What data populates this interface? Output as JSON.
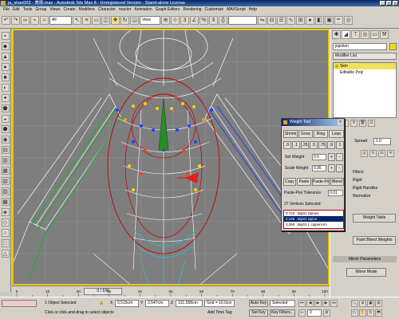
{
  "window": {
    "title": "ja_shan003 - 美術.max - Autodesk 3ds Max 8 - Unregistered Version - Stand-alone License",
    "controls": [
      "_",
      "□",
      "×"
    ]
  },
  "menu": [
    "File",
    "Edit",
    "Tools",
    "Group",
    "Views",
    "Create",
    "Modifiers",
    "Character",
    "reactor",
    "Animation",
    "Graph Editors",
    "Rendering",
    "Customize",
    "MAXScript",
    "Help"
  ],
  "toolbar": {
    "selection_filter": "All",
    "coordinate_system": "View"
  },
  "command_panel": {
    "object_name": "jiqishen",
    "modifier_list_label": "Modifier List",
    "stack": [
      {
        "label": "Skin",
        "active": true
      },
      {
        "label": "Editable Poly",
        "active": false
      }
    ],
    "params": {
      "spinner_label": "Spread",
      "spinner_value": "1.0",
      "filter_label": "Filters",
      "rows": [
        "Rigid",
        "Rigid Handles",
        "Normalize"
      ],
      "weight_table_button": "Weight Table",
      "paint_blend_button": "Paint Blend Weights",
      "mirror_params": "Mirror Parameters",
      "mirror_mode_button": "Mirror Mode"
    }
  },
  "weight_tool": {
    "title": "Weight Tool",
    "buttons_row1": [
      "Shrink",
      "Grow",
      "Ring",
      "Loop"
    ],
    "set_weight_label": "Set Weight",
    "set_weight_value": "0.5",
    "scale_weight_label": "Scale Weight",
    "scale_weight_value": "0.95",
    "preset_weights": [
      ".0",
      ".1",
      ".25",
      ".5",
      ".75",
      ".9",
      "1"
    ],
    "buttons_row2": [
      "Copy",
      "Paste",
      "Paste-Pos",
      "Blend"
    ],
    "paste_tolerance_label": "Paste-Pos Tolerance",
    "paste_tolerance_value": "0.01",
    "vertices_selected": "27 Vertices Selected",
    "bone_list": [
      {
        "text": "0.743 : Bip01 Spine1",
        "selected": false
      },
      {
        "text": "0.226 : Bip01 Spine",
        "selected": true
      },
      {
        "text": "0.250 : Bip01 L UpperArm",
        "selected": false
      }
    ]
  },
  "timeline": {
    "frame": "0 / 100",
    "tick_labels": [
      "0",
      "10",
      "20",
      "30",
      "40",
      "50",
      "60",
      "70",
      "80",
      "90",
      "100"
    ]
  },
  "status": {
    "selection": "1 Object Selected",
    "prompt": "Click or click-and-drag to select objects",
    "x": "0.515cm",
    "y": "3.547cm",
    "z": "131.558cm",
    "grid": "Grid = 10.0cm",
    "auto_key": "Auto Key",
    "set_key": "Set Key",
    "key_filters": "Key Filters...",
    "add_time_tag": "Add Time Tag",
    "selected_mode": "Selected",
    "frame_field": "0"
  },
  "colors": {
    "title_bar": "#0a246a",
    "viewport_bg": "#7e7e7e",
    "viewport_border": "#e8c800",
    "mesh_wire": "#ffffff",
    "envelope_red": "#c00000",
    "vertex_blue": "#2040ff",
    "vertex_yellow": "#ffd000",
    "limb_green": "#3aa040",
    "leg_cyan": "#40b0c0"
  }
}
